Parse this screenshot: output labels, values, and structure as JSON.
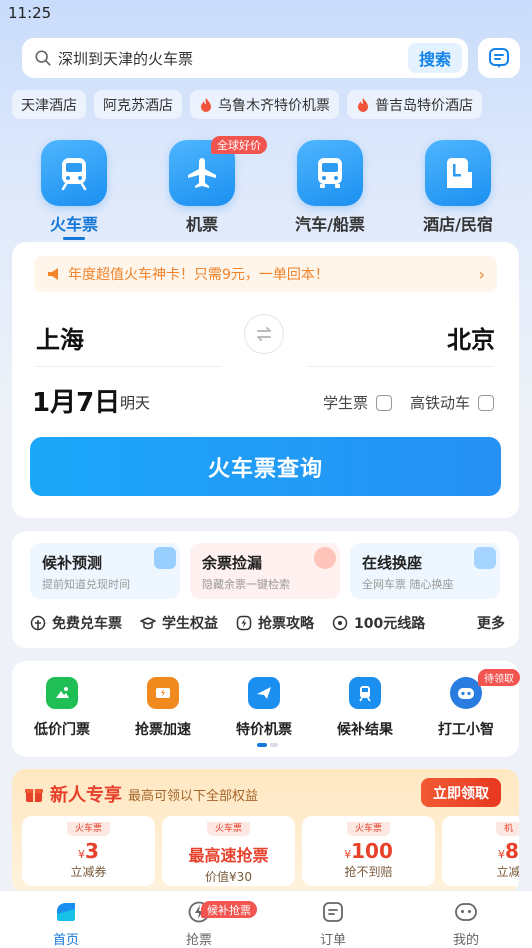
{
  "status_bar": {
    "time": "11:25"
  },
  "search": {
    "placeholder_text": "深圳到天津的火车票",
    "button_label": "搜索"
  },
  "quick_chips": [
    {
      "label": "天津酒店",
      "hot": false
    },
    {
      "label": "阿克苏酒店",
      "hot": false
    },
    {
      "label": "乌鲁木齐特价机票",
      "hot": true
    },
    {
      "label": "普吉岛特价酒店",
      "hot": true
    }
  ],
  "categories": [
    {
      "label": "火车票",
      "icon": "train-icon",
      "active": true
    },
    {
      "label": "机票",
      "icon": "plane-icon",
      "badge": "全球好价"
    },
    {
      "label": "汽车/船票",
      "icon": "bus-icon"
    },
    {
      "label": "酒店/民宿",
      "icon": "hotel-icon"
    }
  ],
  "ticket": {
    "promo": "年度超值火车神卡！只需9元，一单回本！",
    "from_city": "上海",
    "to_city": "北京",
    "date": "1月7日",
    "date_note": "明天",
    "student_label": "学生票",
    "highspeed_label": "高铁动车",
    "query_button": "火车票查询"
  },
  "services": {
    "tiles": [
      {
        "title": "候补预测",
        "subtitle": "提前知道兑现时间"
      },
      {
        "title": "余票捡漏",
        "subtitle": "隐藏余票一键检索"
      },
      {
        "title": "在线换座",
        "subtitle": "全网车票 随心换座"
      }
    ],
    "links": [
      "免费兑车票",
      "学生权益",
      "抢票攻略",
      "100元线路"
    ],
    "more": "更多"
  },
  "grid": [
    {
      "label": "低价门票",
      "icon": "ticket-icon",
      "color": "#1fbf56"
    },
    {
      "label": "抢票加速",
      "icon": "speed-icon",
      "color": "#f08a1f"
    },
    {
      "label": "特价机票",
      "icon": "plane-icon",
      "color": "#1b8ff0"
    },
    {
      "label": "候补结果",
      "icon": "train-icon",
      "color": "#1b8ff0"
    },
    {
      "label": "打工小智",
      "icon": "robot-icon",
      "color": "#2a7de0",
      "badge": "待领取"
    }
  ],
  "newbie": {
    "title": "新人专享",
    "subtitle": "最高可领以下全部权益",
    "claim_button": "立即领取",
    "coupons": [
      {
        "tag": "火车票",
        "currency": "¥",
        "value": "3",
        "caption": "立减券"
      },
      {
        "tag": "火车票",
        "currency": "",
        "value": "最高速抢票",
        "caption": "价值¥30"
      },
      {
        "tag": "火车票",
        "currency": "¥",
        "value": "100",
        "caption": "抢不到赔"
      },
      {
        "tag": "机",
        "currency": "¥",
        "value": "8",
        "caption": "立减"
      }
    ]
  },
  "tabbar": {
    "tabs": [
      {
        "label": "首页",
        "active": true
      },
      {
        "label": "抢票",
        "badge": "候补抢票"
      },
      {
        "label": "订单"
      },
      {
        "label": "我的"
      }
    ]
  },
  "colors": {
    "accent": "#1578d8",
    "primary_button": "#2691f5",
    "promo_orange": "#f0832b",
    "badge_red": "#f25450"
  }
}
